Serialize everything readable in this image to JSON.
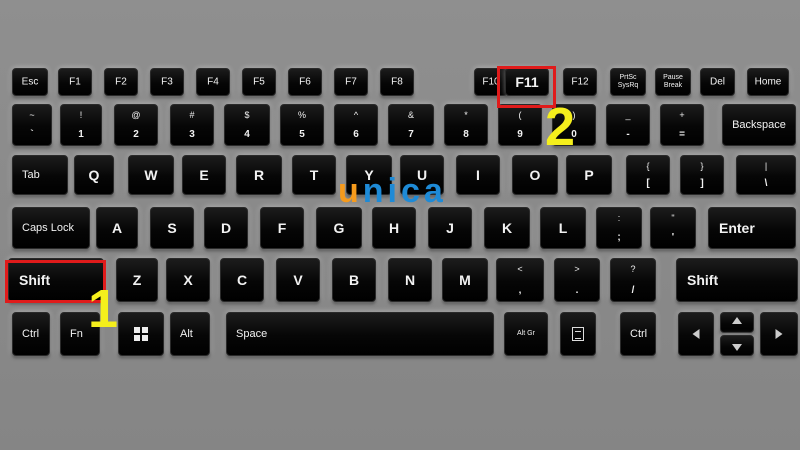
{
  "keyboard": {
    "rows": [
      [
        {
          "label": "Esc"
        },
        {
          "label": "F1"
        },
        {
          "label": "F2"
        },
        {
          "label": "F3"
        },
        {
          "label": "F4"
        },
        {
          "label": "F5"
        },
        {
          "label": "F6"
        },
        {
          "label": "F7"
        },
        {
          "label": "F8"
        },
        {
          "label": "F10"
        },
        {
          "label": "F11",
          "highlight": true
        },
        {
          "label": "F12"
        },
        {
          "label": "PrtSc\nSysRq"
        },
        {
          "label": "Pause\nBreak"
        },
        {
          "label": "Del"
        },
        {
          "label": "Home"
        }
      ],
      [
        {
          "top": "~",
          "bottom": "`"
        },
        {
          "top": "!",
          "bottom": "1"
        },
        {
          "top": "@",
          "bottom": "2"
        },
        {
          "top": "#",
          "bottom": "3"
        },
        {
          "top": "$",
          "bottom": "4"
        },
        {
          "top": "%",
          "bottom": "5"
        },
        {
          "top": "^",
          "bottom": "6"
        },
        {
          "top": "&",
          "bottom": "7"
        },
        {
          "top": "*",
          "bottom": "8"
        },
        {
          "top": "(",
          "bottom": "9"
        },
        {
          "top": ")",
          "bottom": "0"
        },
        {
          "top": "_",
          "bottom": "-"
        },
        {
          "top": "+",
          "bottom": "="
        },
        {
          "label": "Backspace"
        }
      ],
      [
        {
          "label": "Tab"
        },
        {
          "label": "Q"
        },
        {
          "label": "W"
        },
        {
          "label": "E"
        },
        {
          "label": "R"
        },
        {
          "label": "T"
        },
        {
          "label": "Y"
        },
        {
          "label": "U"
        },
        {
          "label": "I"
        },
        {
          "label": "O"
        },
        {
          "label": "P"
        },
        {
          "top": "{",
          "bottom": "["
        },
        {
          "top": "}",
          "bottom": "]"
        },
        {
          "top": "|",
          "bottom": "\\"
        }
      ],
      [
        {
          "label": "Caps Lock"
        },
        {
          "label": "A"
        },
        {
          "label": "S"
        },
        {
          "label": "D"
        },
        {
          "label": "F"
        },
        {
          "label": "G"
        },
        {
          "label": "H"
        },
        {
          "label": "J"
        },
        {
          "label": "K"
        },
        {
          "label": "L"
        },
        {
          "top": ":",
          "bottom": ";"
        },
        {
          "top": "\"",
          "bottom": "'"
        },
        {
          "label": "Enter"
        }
      ],
      [
        {
          "label": "Shift",
          "highlight": true
        },
        {
          "label": "Z"
        },
        {
          "label": "X"
        },
        {
          "label": "C"
        },
        {
          "label": "V"
        },
        {
          "label": "B"
        },
        {
          "label": "N"
        },
        {
          "label": "M"
        },
        {
          "top": "<",
          "bottom": ","
        },
        {
          "top": ">",
          "bottom": "."
        },
        {
          "top": "?",
          "bottom": "/"
        },
        {
          "label": "Shift"
        }
      ],
      [
        {
          "label": "Ctrl"
        },
        {
          "label": "Fn"
        },
        {
          "icon": "windows-icon"
        },
        {
          "label": "Alt"
        },
        {
          "label": "Space"
        },
        {
          "label": "Alt Gr"
        },
        {
          "icon": "menu-icon"
        },
        {
          "label": "Ctrl"
        },
        {
          "icon": "arrow-left-icon"
        },
        {
          "icon": "arrow-up-icon"
        },
        {
          "icon": "arrow-down-icon"
        },
        {
          "icon": "arrow-right-icon"
        }
      ]
    ]
  },
  "annotations": {
    "step1": "1",
    "step2": "2",
    "highlight_color": "#e01b1b",
    "marker_color": "#f5ef1c"
  },
  "watermark": {
    "first": "u",
    "rest": "nica",
    "color_first": "#f59a1c",
    "color_rest": "#1e8ad6"
  }
}
